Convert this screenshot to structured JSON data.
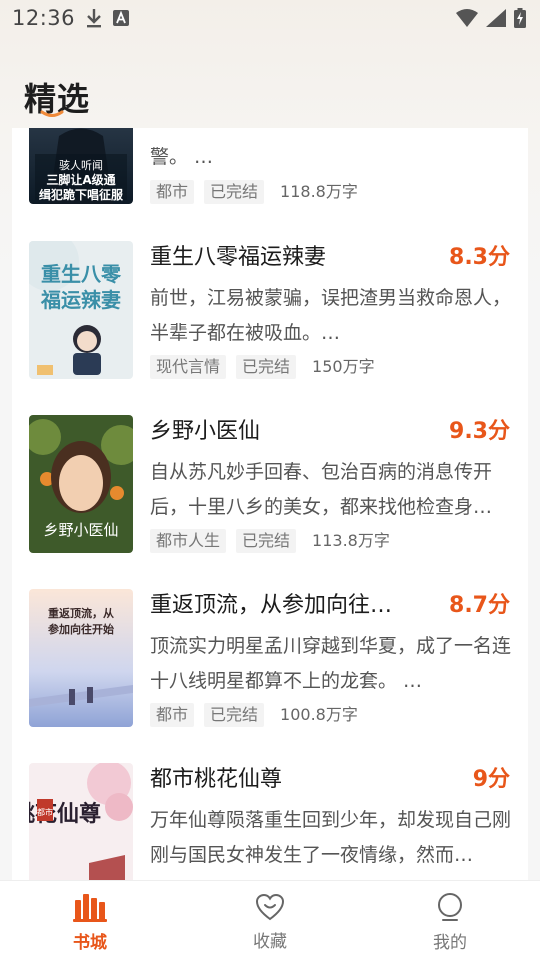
{
  "status_bar": {
    "time": "12:36"
  },
  "header": {
    "title": "精选"
  },
  "books": [
    {
      "title": "",
      "score": "",
      "desc": "警。 …",
      "tags": [
        "都市",
        "已完结"
      ],
      "wordcount": "118.8万字",
      "cover_text": [
        "骇人听闻",
        "三脚让A级通",
        "缉犯跪下唱征服"
      ]
    },
    {
      "title": "重生八零福运辣妻",
      "score": "8.3分",
      "desc": "前世，江易被蒙骗，误把渣男当救命恩人，半辈子都在被吸血。…",
      "tags": [
        "现代言情",
        "已完结"
      ],
      "wordcount": "150万字",
      "cover_text": [
        "重生八零",
        "福运辣妻"
      ]
    },
    {
      "title": "乡野小医仙",
      "score": "9.3分",
      "desc": "自从苏凡妙手回春、包治百病的消息传开后，十里八乡的美女，都来找他检查身…",
      "tags": [
        "都市人生",
        "已完结"
      ],
      "wordcount": "113.8万字",
      "cover_text": [
        "乡野小医仙"
      ]
    },
    {
      "title": "重返顶流，从参加向往…",
      "score": "8.7分",
      "desc": "顶流实力明星孟川穿越到华夏，成了一名连十八线明星都算不上的龙套。 …",
      "tags": [
        "都市",
        "已完结"
      ],
      "wordcount": "100.8万字",
      "cover_text": [
        "重返顶流，从",
        "参加向往开始"
      ]
    },
    {
      "title": "都市桃花仙尊",
      "score": "9分",
      "desc": "万年仙尊陨落重生回到少年，却发现自己刚刚与国民女神发生了一夜情缘，然而…",
      "tags": [],
      "wordcount": "",
      "cover_text": [
        "桃花仙尊",
        "都市"
      ]
    }
  ],
  "tab_bar": {
    "tabs": [
      {
        "label": "书城",
        "icon": "bookshelf-icon",
        "active": true
      },
      {
        "label": "收藏",
        "icon": "heart-icon",
        "active": false
      },
      {
        "label": "我的",
        "icon": "profile-icon",
        "active": false
      }
    ]
  },
  "colors": {
    "accent": "#e8561a",
    "text": "#1c1c1c",
    "muted": "#777777"
  }
}
